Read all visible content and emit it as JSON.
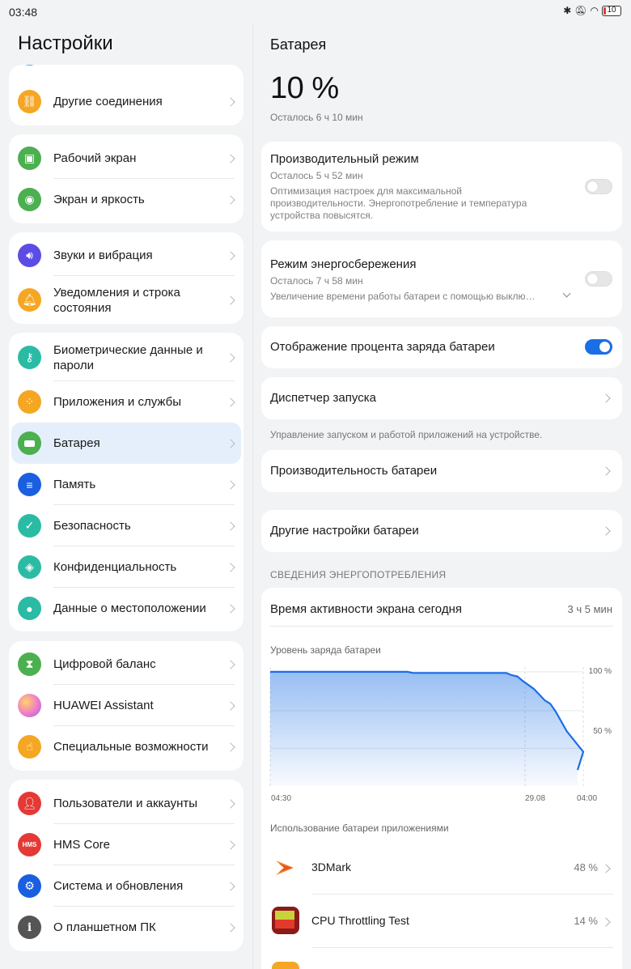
{
  "status_bar": {
    "time": "03:48",
    "battery_level": "10"
  },
  "left": {
    "title": "Настройки",
    "groups": [
      {
        "items": [
          {
            "label": "Другие соединения",
            "icon": "link-icon",
            "color": "#f5a623"
          }
        ]
      },
      {
        "items": [
          {
            "label": "Рабочий экран",
            "icon": "image-icon",
            "color": "#4caf50"
          },
          {
            "label": "Экран и яркость",
            "icon": "eye-icon",
            "color": "#4caf50"
          }
        ]
      },
      {
        "items": [
          {
            "label": "Звуки и вибрация",
            "icon": "speaker-icon",
            "color": "#5b4ce6"
          },
          {
            "label": "Уведомления и строка состояния",
            "icon": "bell-icon",
            "color": "#f5a623"
          }
        ]
      },
      {
        "items": [
          {
            "label": "Биометрические данные и пароли",
            "icon": "key-icon",
            "color": "#2bbba4"
          },
          {
            "label": "Приложения и службы",
            "icon": "apps-icon",
            "color": "#f5a623"
          },
          {
            "label": "Батарея",
            "icon": "battery-icon",
            "color": "#4caf50"
          },
          {
            "label": "Память",
            "icon": "storage-icon",
            "color": "#1a5fe0"
          },
          {
            "label": "Безопасность",
            "icon": "shield-icon",
            "color": "#2bbba4"
          },
          {
            "label": "Конфиденциальность",
            "icon": "privacy-icon",
            "color": "#2bbba4"
          },
          {
            "label": "Данные о местоположении",
            "icon": "location-icon",
            "color": "#2bbba4"
          }
        ]
      },
      {
        "items": [
          {
            "label": "Цифровой баланс",
            "icon": "hourglass-icon",
            "color": "#4caf50"
          },
          {
            "label": "HUAWEI Assistant",
            "icon": "assistant-icon",
            "color": "#e07ad8"
          },
          {
            "label": "Специальные возможности",
            "icon": "hand-icon",
            "color": "#f5a623"
          }
        ]
      },
      {
        "items": [
          {
            "label": "Пользователи и аккаунты",
            "icon": "user-icon",
            "color": "#e53935"
          },
          {
            "label": "HMS Core",
            "icon": "hms-icon",
            "color": "#e53935",
            "badge": "HMS"
          },
          {
            "label": "Система и обновления",
            "icon": "gear-icon",
            "color": "#1a5fe0"
          },
          {
            "label": "О планшетном ПК",
            "icon": "info-icon",
            "color": "#555555"
          }
        ]
      }
    ]
  },
  "right": {
    "title": "Батарея",
    "percent": "10 %",
    "remaining": "Осталось 6 ч 10 мин",
    "perf_mode": {
      "title": "Производительный режим",
      "remaining": "Осталось 5 ч 52 мин",
      "desc": "Оптимизация настроек для максимальной производительности. Энергопотребление и температура устройства повысятся.",
      "enabled": false
    },
    "power_save": {
      "title": "Режим энергосбережения",
      "remaining": "Осталось 7 ч 58 мин",
      "desc": "Увеличение времени работы батареи с помощью выклю…",
      "enabled": false
    },
    "show_percent": {
      "title": "Отображение процента заряда батареи",
      "enabled": true
    },
    "launch_manager": {
      "title": "Диспетчер запуска",
      "note": "Управление запуском и работой приложений на устройстве."
    },
    "battery_perf": {
      "title": "Производительность батареи"
    },
    "other_settings": {
      "title": "Другие настройки батареи"
    },
    "usage_section": "СВЕДЕНИЯ ЭНЕРГОПОТРЕБЛЕНИЯ",
    "screen_time": {
      "label": "Время активности экрана сегодня",
      "value": "3 ч 5 мин"
    },
    "chart_title": "Уровень заряда батареи",
    "apps_title": "Использование батареи приложениями",
    "apps": [
      {
        "name": "3DMark",
        "pct": "48 %",
        "icon": "3dmark-icon"
      },
      {
        "name": "CPU Throttling Test",
        "pct": "14 %",
        "icon": "cpu-throttling-icon"
      }
    ]
  },
  "chart_data": {
    "type": "area",
    "title": "Уровень заряда батареи",
    "x_tick_labels": [
      "04:30",
      "29.08",
      "04:00"
    ],
    "y_tick_labels": [
      "100 %",
      "50 %"
    ],
    "ylim": [
      0,
      100
    ],
    "x_hours": [
      0,
      10,
      12.5,
      13,
      21.5,
      22,
      22.5,
      23,
      24,
      25,
      25.5,
      26,
      27,
      28.5
    ],
    "y_percent": [
      100,
      100,
      100,
      99,
      99,
      97,
      96,
      92,
      85,
      75,
      72,
      65,
      48,
      30,
      14
    ],
    "color": "#1a6ee6"
  }
}
